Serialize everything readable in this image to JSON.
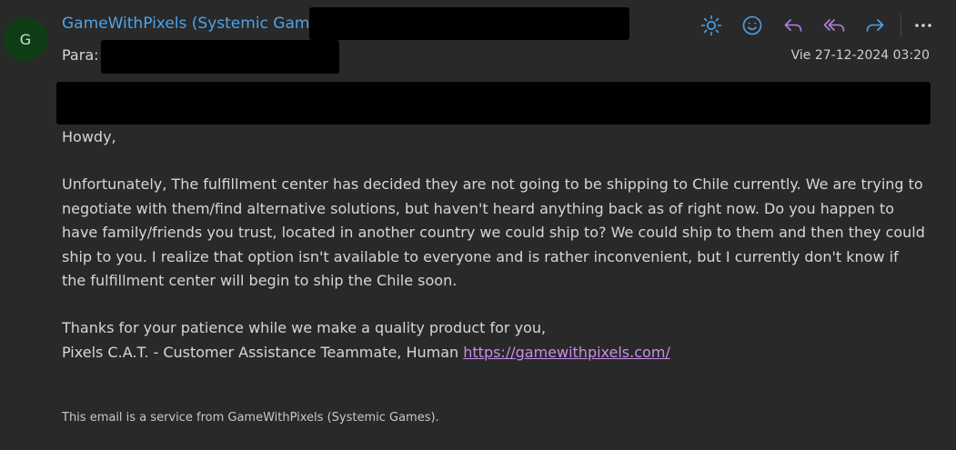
{
  "header": {
    "avatar_initial": "G",
    "sender_name": "GameWithPixels (Systemic Games)",
    "to_label": "Para:",
    "date": "Vie 27-12-2024 03:20"
  },
  "toolbar": {
    "icons": [
      "sun-icon",
      "emoji-icon",
      "reply-icon",
      "reply-all-icon",
      "forward-icon",
      "more-icon"
    ],
    "colors": {
      "sun": "#4fa3e8",
      "emoji": "#4fa3e8",
      "reply": "#b57fe0",
      "reply_all": "#b57fe0",
      "forward": "#4fa3e8",
      "more": "#d6d6d6"
    }
  },
  "body": {
    "greeting": "Howdy,",
    "paragraph": "Unfortunately, The fulfillment center has decided they are not going to be shipping to Chile currently. We are trying to negotiate with them/find alternative solutions, but haven't heard anything back as of right now. Do you happen to have family/friends you trust, located in another country we could ship to?  We could ship to them and then they could ship to you. I realize that option isn't available to everyone and is rather inconvenient, but I currently don't know if the fulfillment center will begin to ship the Chile soon.",
    "thanks": "Thanks for your patience while we make a quality product for you,",
    "signature": "Pixels C.A.T. - Customer Assistance Teammate, Human ",
    "link": "https://gamewithpixels.com/"
  },
  "footer": {
    "text": "This email is a service from GameWithPixels (Systemic Games)."
  },
  "colors": {
    "background": "#292929",
    "sender": "#4fa3e8",
    "link": "#c88ee8",
    "avatar_bg": "#0e3d16"
  }
}
